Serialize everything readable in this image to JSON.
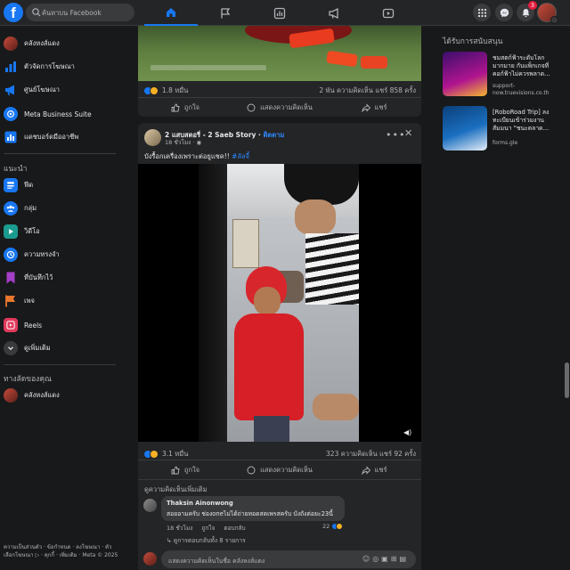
{
  "topbar": {
    "search_placeholder": "ค้นหาบน Facebook",
    "notification_count": "3"
  },
  "sidebar": {
    "profile": "คลังหงส์แดง",
    "items": [
      {
        "label": "ตัวจัดการโฆษณา",
        "icon": "bar-chart-icon",
        "color": "#1877f2"
      },
      {
        "label": "ศูนย์โฆษณา",
        "icon": "megaphone-icon",
        "color": "#1877f2"
      },
      {
        "label": "Meta Business Suite",
        "icon": "meta-business-icon",
        "color": "#1877f2"
      },
      {
        "label": "แดชบอร์ดมืออาชีพ",
        "icon": "dashboard-icon",
        "color": "#1877f2"
      }
    ],
    "recommended_heading": "แนะนำ",
    "recommended": [
      {
        "label": "ฟีด",
        "icon": "feed-icon",
        "color": "#1877f2"
      },
      {
        "label": "กลุ่ม",
        "icon": "groups-icon",
        "color": "#1877f2"
      },
      {
        "label": "วิดีโอ",
        "icon": "video-icon",
        "color": "#1b9b8f"
      },
      {
        "label": "ความทรงจำ",
        "icon": "memories-icon",
        "color": "#1877f2"
      },
      {
        "label": "ที่บันทึกไว้",
        "icon": "saved-icon",
        "color": "#a33ec7"
      },
      {
        "label": "เพจ",
        "icon": "pages-icon",
        "color": "#e8762d"
      },
      {
        "label": "Reels",
        "icon": "reels-icon",
        "color": "#e0395b"
      },
      {
        "label": "ดูเพิ่มเติม",
        "icon": "chevron-down-icon",
        "color": "#3a3b3c"
      }
    ],
    "shortcuts_heading": "ทางลัดของคุณ",
    "shortcut": "คลังหงส์แดง",
    "footer": "ความเป็นส่วนตัว · ข้อกำหนด · ลงโฆษณา · ตัวเลือกโฆษณา ▷ · คุกกี้ · เพิ่มเติม · Meta © 2025"
  },
  "post1": {
    "reactions": "1.8 หมื่น",
    "stats": "2 พัน ความคิดเห็น  แชร์ 858 ครั้ง",
    "like": "ถูกใจ",
    "comment": "แสดงความคิดเห็น",
    "share": "แชร์"
  },
  "post2": {
    "author": "2 แสบสตอรี่ - 2 Saeb Story",
    "follow": "ติดตาม",
    "time": "18 ชั่วโมง · ",
    "caption": "บังรื้อกเครื่องเพราะต่อยูแชค!!",
    "hashtag": "#ลัลจี้",
    "reactions": "3.1 หมื่น",
    "stats": "323 ความคิดเห็น  แชร์ 92 ครั้ง",
    "like": "ถูกใจ",
    "comment": "แสดงความคิดเห็น",
    "share": "แชร์",
    "more_comments": "ดูความคิดเห็นเพิ่มเติม",
    "comment_author": "Thaksin Ainonwong",
    "comment_text": "สอยอามครับ ช่องoneไม่ได้ถ่ายทอดสดเพรสครับ บังถังต่อยะ23นี้",
    "comment_time": "18 ชั่วโมง",
    "comment_like": "ถูกใจ",
    "comment_reply": "ตอบกลับ",
    "comment_reacts": "22",
    "view_replies": "ดูการตอบกลับทั้ง 8 รายการ",
    "write_comment": "แสดงความคิดเห็นในชื่อ คลังหงส์แดง"
  },
  "sponsored": {
    "title": "ได้รับการสนับสนุน",
    "ads": [
      {
        "title": "ชมสตก์ฟ้าระดับโลก มากมาย กับแพ็กเกจที่ คอก์ฟ้าไม่ควรพลาด...",
        "url": "support-now.truevisions.co.th"
      },
      {
        "title": "[RoboRoad Trip] ลงทะเบียนเข้าร่วมงานสัมมนา \"ชนะตลาด...",
        "url": "forms.gle"
      }
    ]
  }
}
